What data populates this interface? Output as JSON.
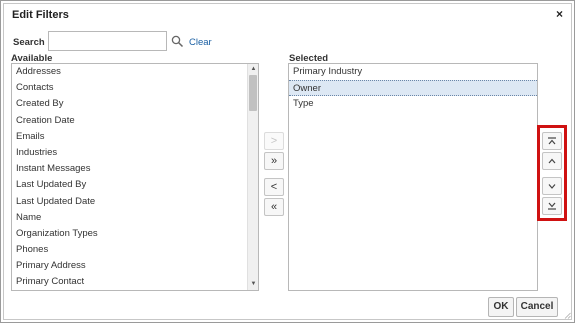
{
  "dialog": {
    "title": "Edit Filters",
    "close_glyph": "×"
  },
  "search": {
    "label": "Search",
    "value": "",
    "placeholder": "",
    "clear_label": "Clear"
  },
  "available": {
    "label": "Available",
    "items": [
      "Addresses",
      "Contacts",
      "Created By",
      "Creation Date",
      "Emails",
      "Industries",
      "Instant Messages",
      "Last Updated By",
      "Last Updated Date",
      "Name",
      "Organization Types",
      "Phones",
      "Primary Address",
      "Primary Contact"
    ]
  },
  "selected": {
    "label": "Selected",
    "items": [
      "Primary Industry",
      "Owner",
      "Type"
    ],
    "highlighted_index": 1
  },
  "move_buttons": {
    "move": ">",
    "move_all": "»",
    "remove": "<",
    "remove_all": "«"
  },
  "footer": {
    "ok_label": "OK",
    "cancel_label": "Cancel"
  },
  "colors": {
    "link": "#1a5fa3",
    "highlight_border": "#cf1111",
    "selected_row": "#dde8f4"
  },
  "icons": {
    "search": "magnifier-icon",
    "close": "close-icon",
    "order_top": "move-to-top-icon",
    "order_up": "move-up-icon",
    "order_down": "move-down-icon",
    "order_bottom": "move-to-bottom-icon"
  }
}
